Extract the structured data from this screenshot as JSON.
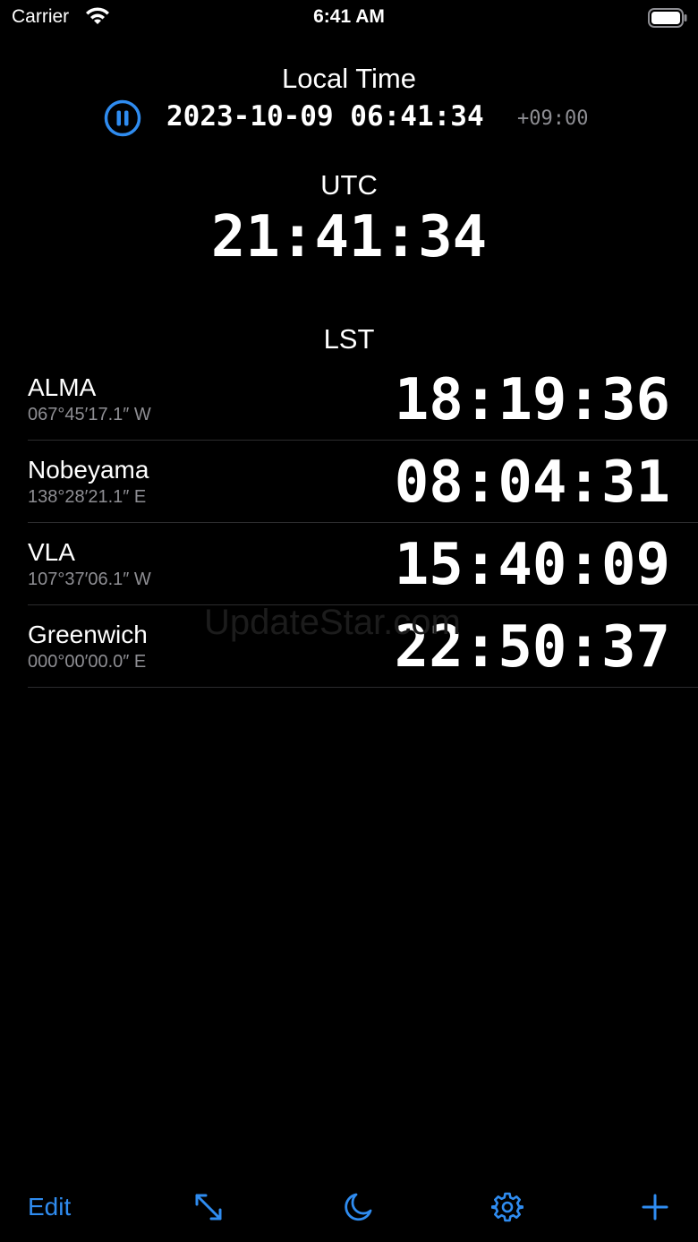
{
  "status_bar": {
    "carrier": "Carrier",
    "time": "6:41 AM"
  },
  "local": {
    "title": "Local Time",
    "datetime": "2023-10-09 06:41:34",
    "offset": "+09:00"
  },
  "utc": {
    "title": "UTC",
    "time": "21:41:34"
  },
  "lst": {
    "title": "LST",
    "sites": [
      {
        "name": "ALMA",
        "longitude": "067°45′17.1″ W",
        "lst": "18:19:36"
      },
      {
        "name": "Nobeyama",
        "longitude": "138°28′21.1″ E",
        "lst": "08:04:31"
      },
      {
        "name": "VLA",
        "longitude": "107°37′06.1″ W",
        "lst": "15:40:09"
      },
      {
        "name": "Greenwich",
        "longitude": "000°00′00.0″ E",
        "lst": "22:50:37"
      }
    ]
  },
  "watermark": "UpdateStar.com",
  "toolbar": {
    "edit_label": "Edit",
    "icons": [
      "expand-icon",
      "moon-icon",
      "gear-icon",
      "plus-icon"
    ]
  },
  "colors": {
    "accent": "#2f8cf0",
    "secondary_text": "#8e8e93",
    "background": "#000000"
  }
}
